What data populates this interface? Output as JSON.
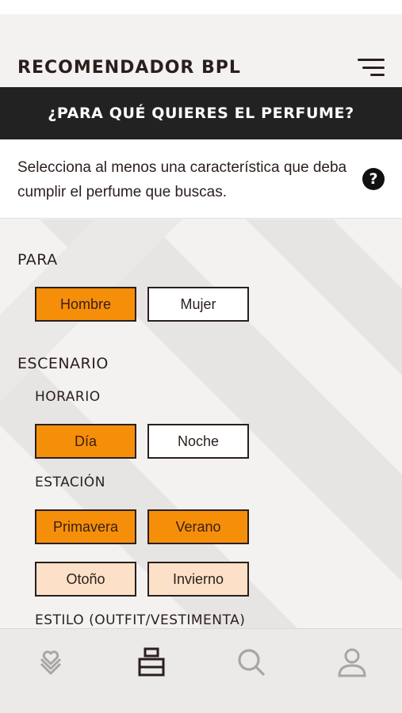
{
  "header": {
    "title": "RECOMENDADOR BPL",
    "menu_icon": "hamburger-icon"
  },
  "banner": {
    "title": "¿PARA QUÉ QUIERES EL PERFUME?"
  },
  "intro": {
    "text": "Selecciona al menos una característica que deba cumplir el perfume que buscas.",
    "help_icon": "question-icon"
  },
  "sections": {
    "para": {
      "title": "PARA",
      "options": [
        {
          "label": "Hombre",
          "state": "selected"
        },
        {
          "label": "Mujer",
          "state": "unselected"
        }
      ]
    },
    "escenario": {
      "title": "ESCENARIO",
      "horario": {
        "title": "HORARIO",
        "options": [
          {
            "label": "Día",
            "state": "selected"
          },
          {
            "label": "Noche",
            "state": "unselected"
          }
        ]
      },
      "estacion": {
        "title": "ESTACIÓN",
        "options": [
          {
            "label": "Primavera",
            "state": "selected"
          },
          {
            "label": "Verano",
            "state": "selected"
          },
          {
            "label": "Otoño",
            "state": "light"
          },
          {
            "label": "Invierno",
            "state": "light"
          }
        ]
      },
      "estilo": {
        "title": "ESTILO (OUTFIT/VESTIMENTA)"
      }
    }
  },
  "tabbar": {
    "tabs": [
      {
        "icon": "layers-heart-icon",
        "active": false
      },
      {
        "icon": "perfume-bottle-icon",
        "active": true
      },
      {
        "icon": "search-icon",
        "active": false
      },
      {
        "icon": "user-icon",
        "active": false
      }
    ]
  },
  "colors": {
    "selected": "#f58f0a",
    "light": "#fce0c7",
    "banner": "#222222",
    "text": "#2a1f1c"
  }
}
